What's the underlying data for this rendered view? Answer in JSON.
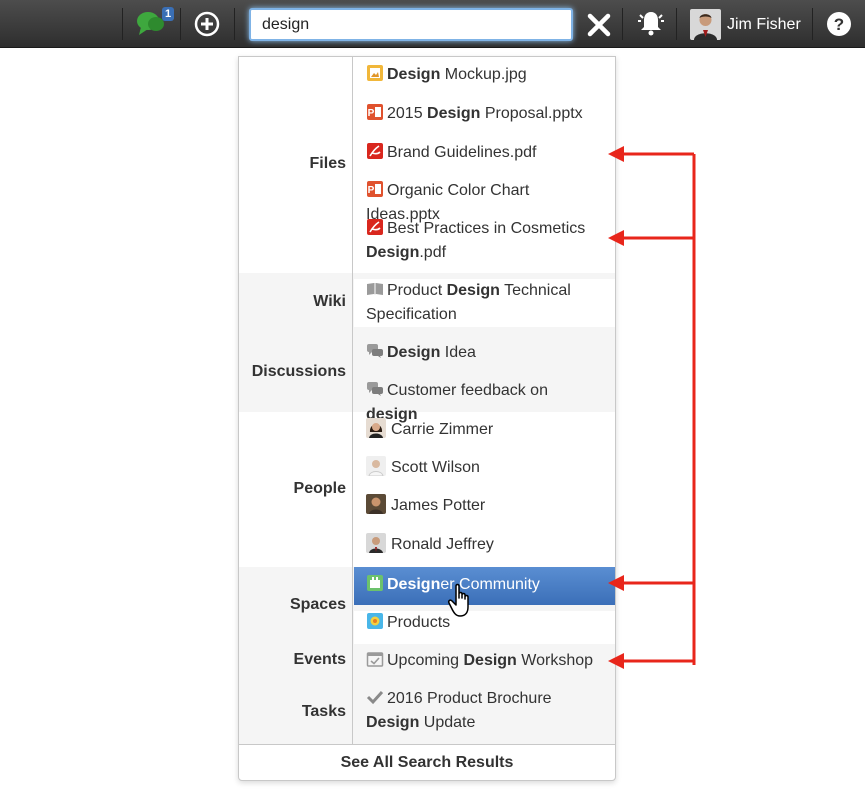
{
  "topbar": {
    "chat_badge": "1",
    "search": {
      "value": "design",
      "placeholder": ""
    },
    "user_name": "Jim Fisher"
  },
  "results": {
    "groups": [
      {
        "label": "Files",
        "items": [
          {
            "icon": "image-file-icon",
            "pre": "",
            "bold": "Design",
            "post": " Mockup.jpg"
          },
          {
            "icon": "pptx-file-icon",
            "pre": "2015 ",
            "bold": "Design",
            "post": " Proposal.pptx"
          },
          {
            "icon": "pdf-file-icon",
            "pre": "Brand Guidelines.pdf",
            "bold": "",
            "post": ""
          },
          {
            "icon": "pptx-file-icon",
            "pre": "Organic Color Chart Ideas.pptx",
            "bold": "",
            "post": ""
          },
          {
            "icon": "pdf-file-icon",
            "pre": "Best Practices in Cosmetics ",
            "bold": "Design",
            "post": ".pdf"
          }
        ]
      },
      {
        "label": "Wiki",
        "items": [
          {
            "icon": "book-icon",
            "pre": "Product ",
            "bold": "Design",
            "post": " Technical Specification"
          }
        ]
      },
      {
        "label": "Discussions",
        "items": [
          {
            "icon": "discussion-icon",
            "pre": "",
            "bold": "Design",
            "post": " Idea"
          },
          {
            "icon": "discussion-icon",
            "pre": "Customer feedback on ",
            "bold": "design",
            "post": ""
          }
        ]
      },
      {
        "label": "People",
        "items": [
          {
            "icon": "person-avatar",
            "pre": "Carrie Zimmer",
            "bold": "",
            "post": ""
          },
          {
            "icon": "person-avatar",
            "pre": "Scott Wilson",
            "bold": "",
            "post": ""
          },
          {
            "icon": "person-avatar",
            "pre": "James Potter",
            "bold": "",
            "post": ""
          },
          {
            "icon": "person-avatar",
            "pre": "Ronald Jeffrey",
            "bold": "",
            "post": ""
          }
        ]
      },
      {
        "label": "Spaces",
        "items": [
          {
            "icon": "space-icon",
            "pre": "",
            "bold": "Design",
            "post": "er Community"
          },
          {
            "icon": "space-icon",
            "pre": "Products",
            "bold": "",
            "post": ""
          }
        ]
      },
      {
        "label": "Events",
        "items": [
          {
            "icon": "calendar-icon",
            "pre": "Upcoming ",
            "bold": "Design",
            "post": " Workshop"
          }
        ]
      },
      {
        "label": "Tasks",
        "items": [
          {
            "icon": "checkmark-icon",
            "pre": "2016 Product Brochure ",
            "bold": "Design",
            "post": " Update"
          }
        ]
      }
    ],
    "see_all": "See All Search Results"
  },
  "colors": {
    "accent": "#3b6fb8",
    "arrow": "#e8261b",
    "topbar": "#3c3c3c"
  }
}
